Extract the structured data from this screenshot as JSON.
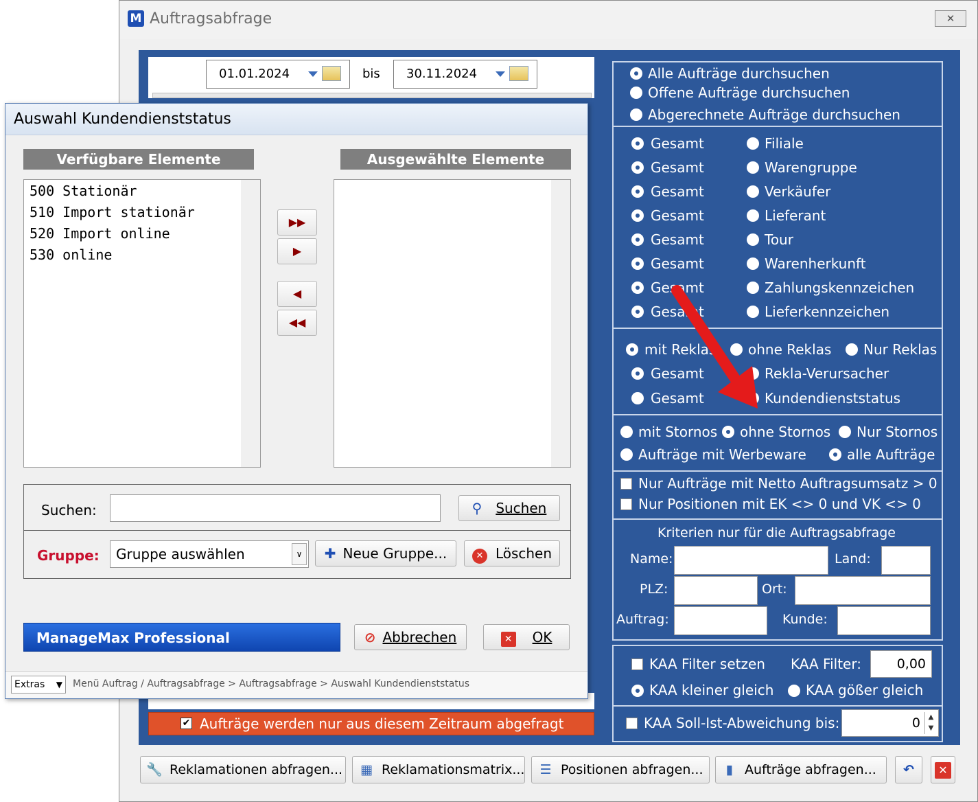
{
  "window": {
    "title": "Auftragsabfrage",
    "close_icon": "close-icon"
  },
  "dates": {
    "from": "01.01.2024",
    "bis": "bis",
    "to": "30.11.2024"
  },
  "right": {
    "search_scope": [
      {
        "label": "Alle Aufträge durchsuchen",
        "checked": true
      },
      {
        "label": "Offene Aufträge durchsuchen",
        "checked": false
      },
      {
        "label": "Abgerechnete Aufträge durchsuchen",
        "checked": false
      }
    ],
    "filters": [
      {
        "gesamt": "Gesamt",
        "option": "Filiale"
      },
      {
        "gesamt": "Gesamt",
        "option": "Warengruppe"
      },
      {
        "gesamt": "Gesamt",
        "option": "Verkäufer"
      },
      {
        "gesamt": "Gesamt",
        "option": "Lieferant"
      },
      {
        "gesamt": "Gesamt",
        "option": "Tour"
      },
      {
        "gesamt": "Gesamt",
        "option": "Warenherkunft"
      },
      {
        "gesamt": "Gesamt",
        "option": "Zahlungskennzeichen"
      },
      {
        "gesamt": "Gesamt",
        "option": "Lieferkennzeichen"
      }
    ],
    "reklas": {
      "mit": "mit Reklas",
      "ohne": "ohne Reklas",
      "nur": "Nur Reklas",
      "gesamt1": "Gesamt",
      "verursacher": "Rekla-Verursacher",
      "gesamt2": "Gesamt",
      "kundendienst": "Kundendienststatus"
    },
    "storno": {
      "mit": "mit Stornos",
      "ohne": "ohne Stornos",
      "nur": "Nur Stornos",
      "werbe": "Aufträge mit Werbeware",
      "alle": "alle Aufträge"
    },
    "checks": {
      "netto": "Nur Aufträge mit Netto Auftragsumsatz > 0",
      "ekvk": "Nur Positionen mit EK <> 0 und VK <> 0"
    },
    "criteria": {
      "title": "Kriterien nur für die Auftragsabfrage",
      "name": "Name:",
      "land": "Land:",
      "plz": "PLZ:",
      "ort": "Ort:",
      "auftrag": "Auftrag:",
      "kunde": "Kunde:"
    },
    "kaa": {
      "filter_set": "KAA Filter setzen",
      "filter_label": "KAA Filter:",
      "filter_value": "0,00",
      "kleiner": "KAA kleiner gleich",
      "groesser": "KAA gößer gleich",
      "soll_ist": "KAA Soll-Ist-Abweichung bis:",
      "soll_ist_value": "0"
    }
  },
  "left_bottom": {
    "zeitraum": "Aufträge werden nur aus diesem Zeitraum abgefragt",
    "accent": "#e0522a"
  },
  "buttons": {
    "reklamationen": "Reklamationen abfragen...",
    "matrix": "Reklamationsmatrix...",
    "positionen": "Positionen abfragen...",
    "auftraege": "Aufträge abfragen..."
  },
  "dialog": {
    "title": "Auswahl Kundendienststatus",
    "available_header": "Verfügbare Elemente",
    "selected_header": "Ausgewählte Elemente",
    "available": [
      "500 Stationär",
      "510 Import stationär",
      "520 Import online",
      "530 online"
    ],
    "suchen_label": "Suchen:",
    "suchen_button": "Suchen",
    "gruppe_label": "Gruppe:",
    "gruppe_value": "Gruppe auswählen",
    "neue_gruppe": "Neue Gruppe...",
    "loeschen": "Löschen",
    "brand": "ManageMax Professional",
    "abbrechen": "Abbrechen",
    "ok": "OK",
    "extras": "Extras",
    "breadcrumb": "Menü Auftrag / Auftragsabfrage > Auftragsabfrage > Auswahl Kundendienststatus"
  },
  "colors": {
    "panel_blue": "#2d589a",
    "arrow_red": "#e41b1b",
    "brand_blue": "#1a56c8"
  }
}
